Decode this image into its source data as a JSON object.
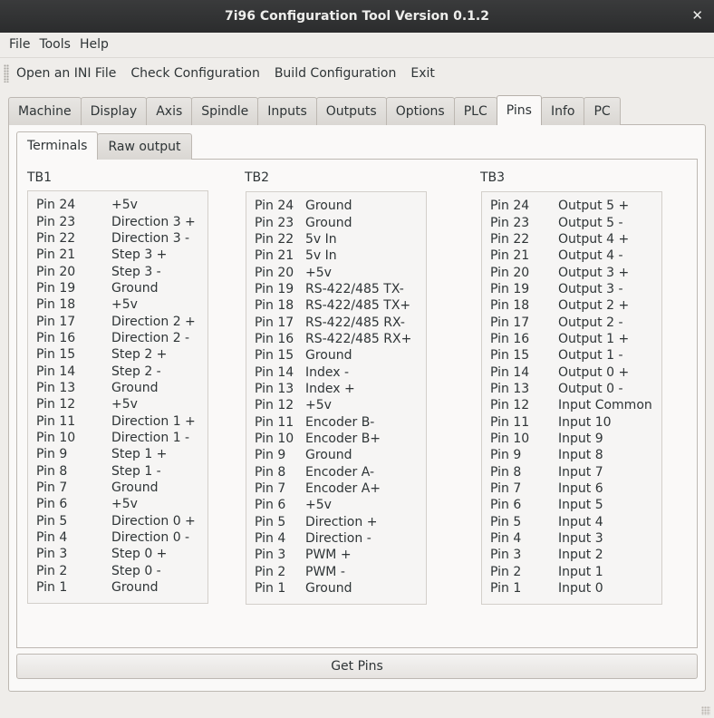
{
  "window": {
    "title": "7i96 Configuration Tool Version 0.1.2",
    "close_glyph": "✕"
  },
  "menubar": [
    "File",
    "Tools",
    "Help"
  ],
  "toolbar": [
    "Open an INI File",
    "Check Configuration",
    "Build Configuration",
    "Exit"
  ],
  "tabs": [
    "Machine",
    "Display",
    "Axis",
    "Spindle",
    "Inputs",
    "Outputs",
    "Options",
    "PLC",
    "Pins",
    "Info",
    "PC"
  ],
  "active_tab": "Pins",
  "subtabs": [
    "Terminals",
    "Raw output"
  ],
  "active_subtab": "Terminals",
  "terminals": {
    "tb1": {
      "label": "TB1",
      "pins": [
        [
          "Pin 24",
          "+5v"
        ],
        [
          "Pin 23",
          "Direction 3 +"
        ],
        [
          "Pin 22",
          "Direction 3 -"
        ],
        [
          "Pin 21",
          "Step 3 +"
        ],
        [
          "Pin 20",
          "Step 3 -"
        ],
        [
          "Pin 19",
          "Ground"
        ],
        [
          "Pin 18",
          "+5v"
        ],
        [
          "Pin 17",
          "Direction 2 +"
        ],
        [
          "Pin 16",
          "Direction 2 -"
        ],
        [
          "Pin 15",
          "Step 2 +"
        ],
        [
          "Pin 14",
          "Step 2 -"
        ],
        [
          "Pin 13",
          "Ground"
        ],
        [
          "Pin 12",
          "+5v"
        ],
        [
          "Pin 11",
          "Direction 1 +"
        ],
        [
          "Pin 10",
          "Direction 1 -"
        ],
        [
          "Pin 9",
          "Step 1 +"
        ],
        [
          "Pin 8",
          "Step 1 -"
        ],
        [
          "Pin 7",
          "Ground"
        ],
        [
          "Pin 6",
          "+5v"
        ],
        [
          "Pin 5",
          "Direction 0 +"
        ],
        [
          "Pin 4",
          "Direction 0 -"
        ],
        [
          "Pin 3",
          "Step 0 +"
        ],
        [
          "Pin 2",
          "Step 0 -"
        ],
        [
          "Pin 1",
          "Ground"
        ]
      ]
    },
    "tb2": {
      "label": "TB2",
      "pins": [
        [
          "Pin 24",
          "Ground"
        ],
        [
          "Pin 23",
          "Ground"
        ],
        [
          "Pin 22",
          "5v In"
        ],
        [
          "Pin 21",
          "5v In"
        ],
        [
          "Pin 20",
          "+5v"
        ],
        [
          "Pin 19",
          "RS-422/485 TX-"
        ],
        [
          "Pin 18",
          "RS-422/485 TX+"
        ],
        [
          "Pin 17",
          "RS-422/485 RX-"
        ],
        [
          "Pin 16",
          "RS-422/485 RX+"
        ],
        [
          "Pin 15",
          "Ground"
        ],
        [
          "Pin 14",
          "Index -"
        ],
        [
          "Pin 13",
          "Index +"
        ],
        [
          "Pin 12",
          "+5v"
        ],
        [
          "Pin 11",
          "Encoder B-"
        ],
        [
          "Pin 10",
          "Encoder B+"
        ],
        [
          "Pin 9",
          "Ground"
        ],
        [
          "Pin 8",
          "Encoder A-"
        ],
        [
          "Pin 7",
          "Encoder A+"
        ],
        [
          "Pin 6",
          "+5v"
        ],
        [
          "Pin 5",
          "Direction +"
        ],
        [
          "Pin 4",
          "Direction -"
        ],
        [
          "Pin 3",
          "PWM +"
        ],
        [
          "Pin 2",
          "PWM -"
        ],
        [
          "Pin 1",
          "Ground"
        ]
      ]
    },
    "tb3": {
      "label": "TB3",
      "pins": [
        [
          "Pin 24",
          "Output 5 +"
        ],
        [
          "Pin 23",
          "Output 5 -"
        ],
        [
          "Pin 22",
          "Output 4 +"
        ],
        [
          "Pin 21",
          "Output 4 -"
        ],
        [
          "Pin 20",
          "Output 3 +"
        ],
        [
          "Pin 19",
          "Output 3 -"
        ],
        [
          "Pin 18",
          "Output 2 +"
        ],
        [
          "Pin 17",
          "Output 2 -"
        ],
        [
          "Pin 16",
          "Output 1 +"
        ],
        [
          "Pin 15",
          "Output 1 -"
        ],
        [
          "Pin 14",
          "Output 0 +"
        ],
        [
          "Pin 13",
          "Output 0 -"
        ],
        [
          "Pin 12",
          "Input Common"
        ],
        [
          "Pin 11",
          "Input 10"
        ],
        [
          "Pin 10",
          "Input 9"
        ],
        [
          "Pin 9",
          "Input 8"
        ],
        [
          "Pin 8",
          "Input 7"
        ],
        [
          "Pin 7",
          "Input 6"
        ],
        [
          "Pin 6",
          "Input 5"
        ],
        [
          "Pin 5",
          "Input 4"
        ],
        [
          "Pin 4",
          "Input 3"
        ],
        [
          "Pin 3",
          "Input 2"
        ],
        [
          "Pin 2",
          "Input 1"
        ],
        [
          "Pin 1",
          "Input 0"
        ]
      ]
    }
  },
  "get_pins_label": "Get Pins"
}
